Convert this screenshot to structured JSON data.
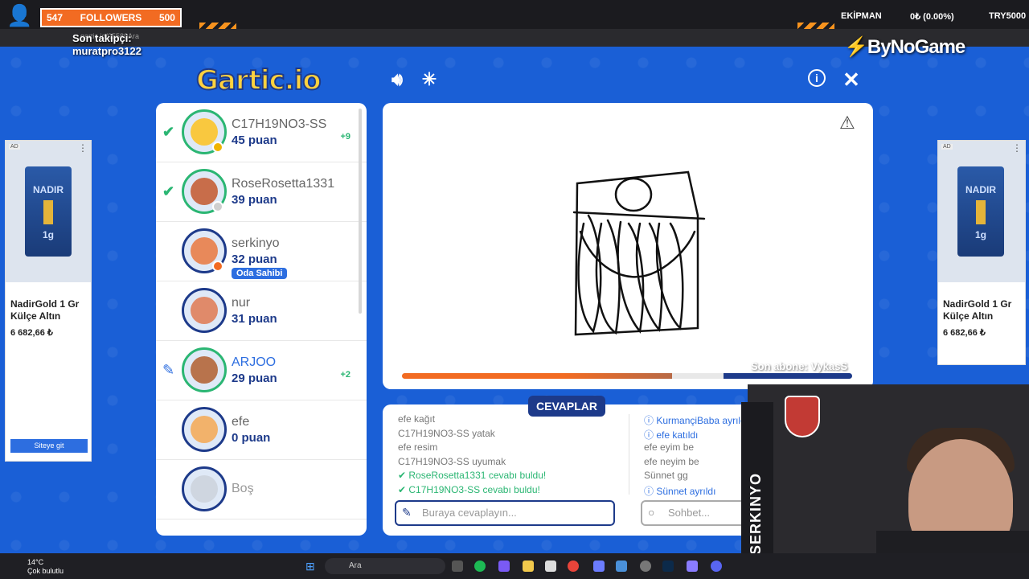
{
  "stream": {
    "followers_current": "547",
    "followers_label": "FOLLOWERS",
    "followers_goal": "500",
    "last_follower_label": "Son takipçi:",
    "last_follower_name": "muratpro3122",
    "ekipman_label": "EKİPMAN",
    "price_change": "0₺ (0.00%)",
    "ticker": "TRY5000",
    "brand": "ByNoGame",
    "last_sub": "Son abone: VykasS",
    "url": "gartic.io/05580Ara",
    "cam_name": "SERKINYO"
  },
  "game": {
    "logo": "Gartic.io",
    "players": [
      {
        "name": "C17H19NO3-SS",
        "points": "45 puan",
        "bonus": "+9",
        "status": "check",
        "face": "#f9c83f",
        "dot": "#f0b400"
      },
      {
        "name": "RoseRosetta1331",
        "points": "39 puan",
        "bonus": "",
        "status": "check",
        "face": "#c86d4a",
        "dot": "#cfcfcf"
      },
      {
        "name": "serkinyo",
        "points": "32 puan",
        "bonus": "",
        "status": "",
        "face": "#e8895a",
        "dot": "#f26b22",
        "badge": "Oda Sahibi"
      },
      {
        "name": "nur",
        "points": "31 puan",
        "bonus": "",
        "status": "",
        "face": "#e08a6a",
        "dot": ""
      },
      {
        "name": "ARJOO",
        "points": "29 puan",
        "bonus": "+2",
        "status": "pencil",
        "face": "#b8734c",
        "dot": ""
      },
      {
        "name": "efe",
        "points": "0 puan",
        "bonus": "",
        "status": "",
        "face": "#f2b26b",
        "dot": ""
      },
      {
        "name": "Boş",
        "points": "",
        "bonus": "",
        "status": "",
        "face": "#cfd6e0",
        "dot": ""
      }
    ],
    "answers_tab": "CEVAPLAR",
    "answers": [
      {
        "user": "efe",
        "text": "kağıt",
        "type": "plain"
      },
      {
        "user": "C17H19NO3-SS",
        "text": "yatak",
        "type": "plain"
      },
      {
        "user": "efe",
        "text": "resim",
        "type": "plain"
      },
      {
        "user": "C17H19NO3-SS",
        "text": "uyumak",
        "type": "plain"
      },
      {
        "user": "RoseRosetta1331",
        "text": "cevabı buldu!",
        "type": "ok"
      },
      {
        "user": "C17H19NO3-SS",
        "text": "cevabı buldu!",
        "type": "ok"
      }
    ],
    "chat": [
      {
        "user": "KurmançiBaba",
        "text": "ayrıldı",
        "type": "info"
      },
      {
        "user": "efe",
        "text": "katıldı",
        "type": "info"
      },
      {
        "user": "efe",
        "text": "eyim be",
        "type": "plain"
      },
      {
        "user": "efe",
        "text": "neyim be",
        "type": "plain"
      },
      {
        "user": "Sünnet",
        "text": "gg",
        "type": "plain"
      },
      {
        "user": "Sünnet",
        "text": "ayrıldı",
        "type": "info"
      }
    ],
    "answer_placeholder": "Buraya cevaplayın...",
    "chat_placeholder": "Sohbet...",
    "progress": 0.6
  },
  "ads": {
    "product": "NADIR",
    "weight": "1g",
    "title": "NadirGold 1 Gr Külçe Altın",
    "price": "6 682,66 ₺",
    "button": "Siteye git",
    "ad_tag": "AD"
  },
  "taskbar": {
    "temp": "14°C",
    "weather": "Çok bulutlu",
    "search": "Ara"
  }
}
